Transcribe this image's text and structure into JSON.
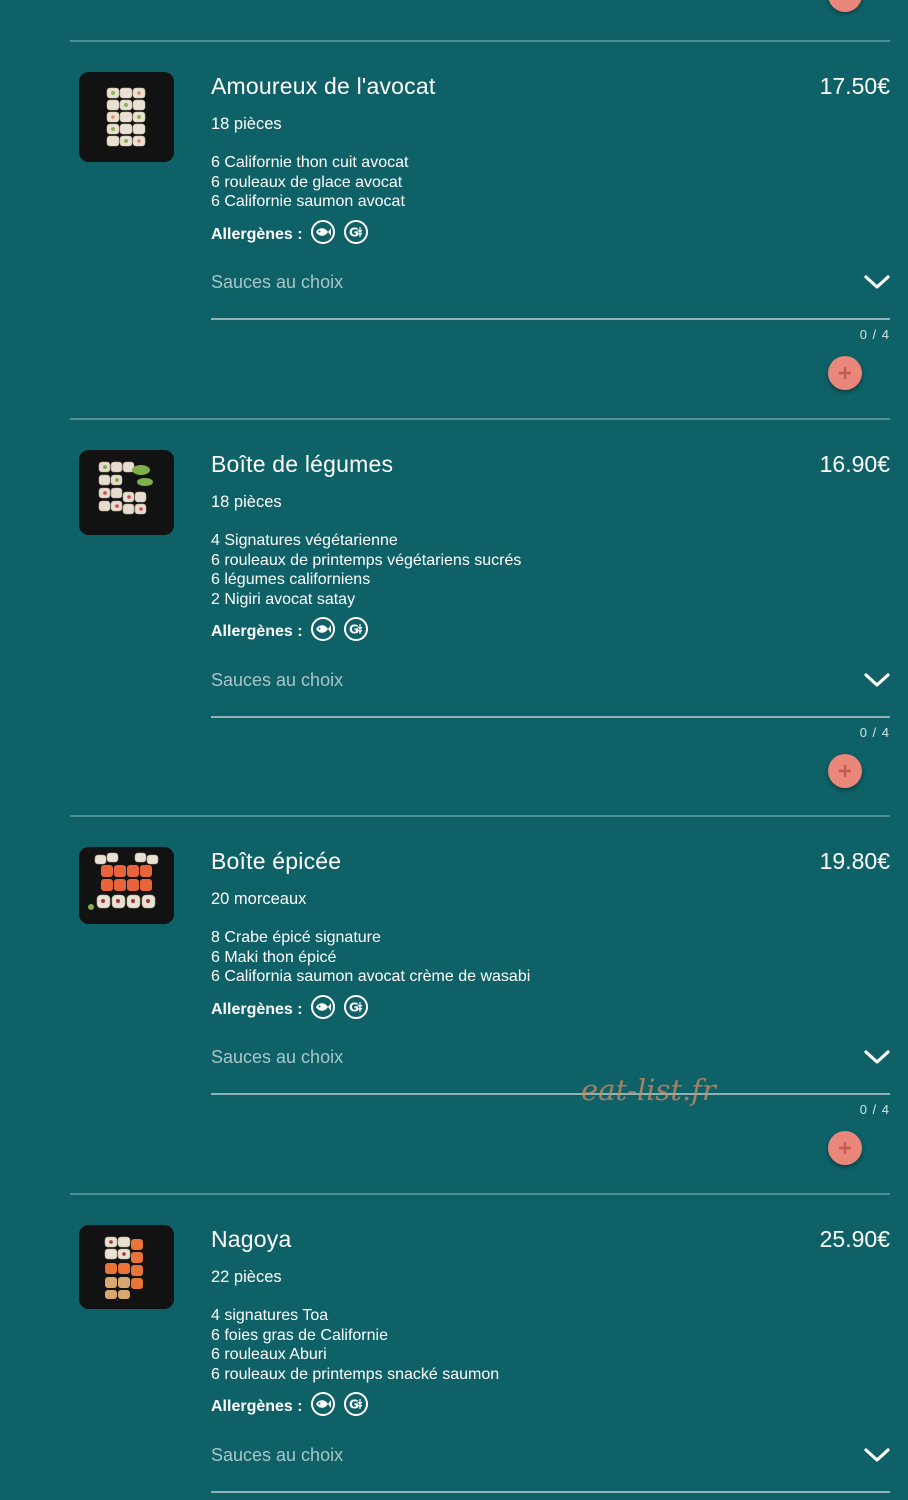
{
  "colors": {
    "background": "#0f6168",
    "accent": "#e8877a",
    "muted_text": "#a8c6c8"
  },
  "labels": {
    "allergens": "Allergènes :",
    "sauces": "Sauces au choix",
    "counter": "0 / 4"
  },
  "allergen_icons": [
    "fish-icon",
    "gluten-icon"
  ],
  "items": [
    {
      "name": "Amoureux de l'avocat",
      "price": "17.50€",
      "pieces": "18 pièces",
      "desc": [
        "6 Californie thon cuit avocat",
        "6 rouleaux de glace avocat",
        "6 Californie saumon avocat"
      ]
    },
    {
      "name": "Boîte de légumes",
      "price": "16.90€",
      "pieces": "18 pièces",
      "desc": [
        "4 Signatures végétarienne",
        "6 rouleaux de printemps végétariens sucrés",
        "6 légumes californiens",
        "2 Nigiri avocat satay"
      ]
    },
    {
      "name": "Boîte épicée",
      "price": "19.80€",
      "pieces": "20 morceaux",
      "desc": [
        "8 Crabe épicé signature",
        "6 Maki thon épicé",
        "6 California saumon avocat crème de wasabi"
      ]
    },
    {
      "name": "Nagoya",
      "price": "25.90€",
      "pieces": "22 pièces",
      "desc": [
        "4 signatures Toa",
        "6 foies gras de Californie",
        "6 rouleaux Aburi",
        "6 rouleaux de printemps snacké saumon"
      ]
    }
  ],
  "watermark": "eat-list.fr"
}
